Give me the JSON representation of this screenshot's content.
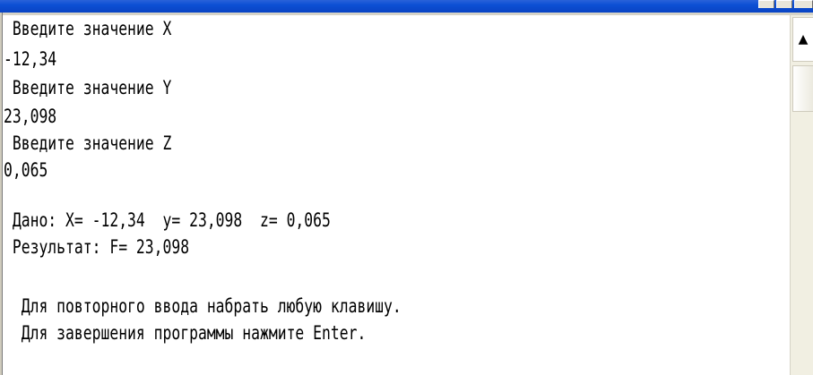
{
  "console": {
    "lines": [
      " Введите значение X",
      "-12,34",
      " Введите значение Y",
      "23,098",
      " Введите значение Z",
      "0,065",
      "",
      " Дано: X= -12,34  y= 23,098  z= 0,065",
      " Результат: F= 23,098",
      "",
      "  Для повторного ввода набрать любую клавишу.",
      "  Для завершения программы нажмите Enter."
    ]
  },
  "scrollbar": {
    "up_arrow": "▲"
  },
  "colors": {
    "background": "#ffffff",
    "text": "#000000",
    "titlebar": "#0c4fd4"
  },
  "icons": {
    "scroll_up": "scroll-up-arrow-icon"
  }
}
